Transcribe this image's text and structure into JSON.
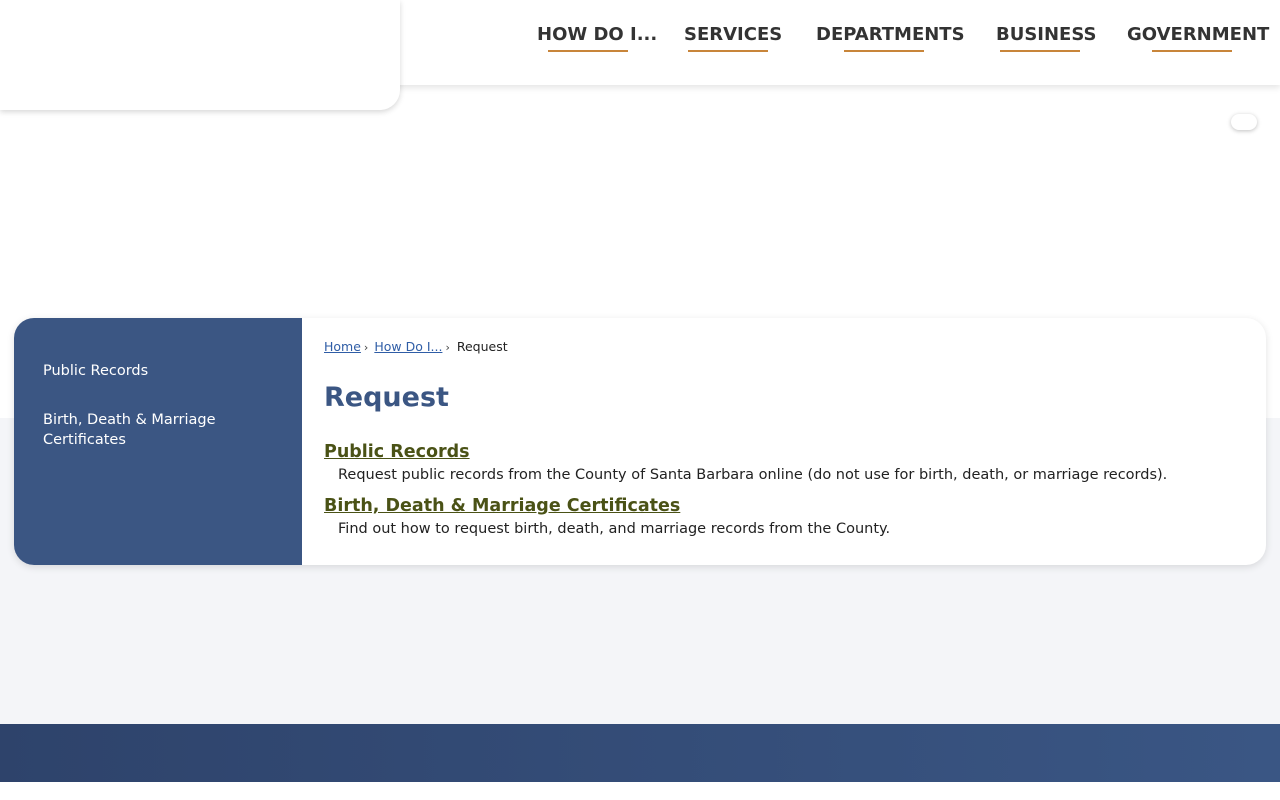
{
  "nav": {
    "items": [
      {
        "label": "HOW DO I..."
      },
      {
        "label": "SERVICES"
      },
      {
        "label": "DEPARTMENTS"
      },
      {
        "label": "BUSINESS"
      },
      {
        "label": "GOVERNMENT"
      }
    ]
  },
  "sidebar": {
    "items": [
      {
        "label": "Public Records"
      },
      {
        "label": "Birth, Death & Marriage Certificates"
      }
    ]
  },
  "breadcrumb": {
    "home": "Home",
    "separator": "›",
    "how_do_i": "How Do I...",
    "current": "Request"
  },
  "page": {
    "title": "Request"
  },
  "entries": [
    {
      "title": "Public Records",
      "description": "Request public records from the County of Santa Barbara online (do not use for birth, death, or marriage records)."
    },
    {
      "title": "Birth, Death & Marriage Certificates",
      "description": "Find out how to request birth, death, and marriage records from the County."
    }
  ],
  "colors": {
    "brand_blue": "#3b5683",
    "accent_orange": "#c8853a",
    "link_olive": "#4a5216",
    "breadcrumb_link": "#2f5da6"
  }
}
